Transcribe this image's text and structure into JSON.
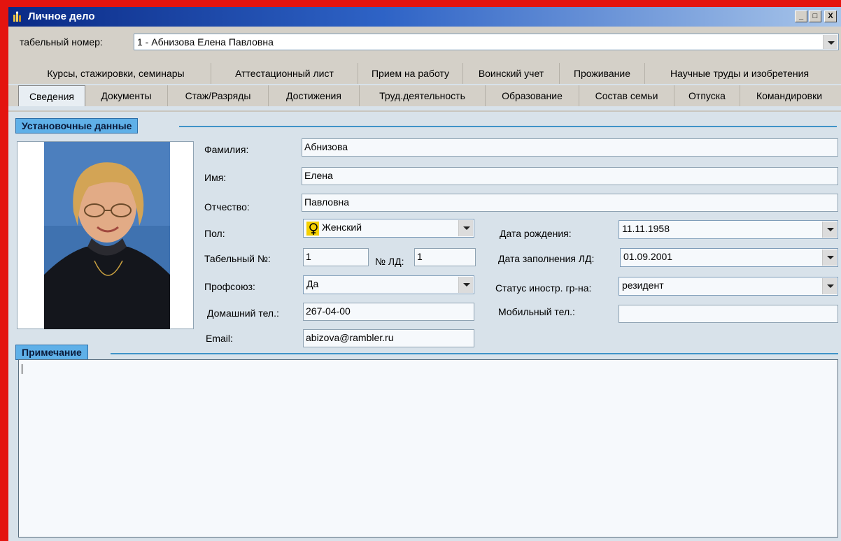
{
  "window": {
    "title": "Личное дело",
    "minimize": "_",
    "maximize": "□",
    "close": "X"
  },
  "header": {
    "tab_number_label": "табельный номер:",
    "tab_number_value": "1 - Абнизова Елена Павловна"
  },
  "tabs_row1": [
    "Курсы, стажировки, семинары",
    "Аттестационный лист",
    "Прием на работу",
    "Воинский учет",
    "Проживание",
    "Научные труды и изобретения"
  ],
  "tabs_row2": [
    "Сведения",
    "Документы",
    "Стаж/Разряды",
    "Достижения",
    "Труд.деятельность",
    "Образование",
    "Состав семьи",
    "Отпуска",
    "Командировки"
  ],
  "active_tab": "Сведения",
  "sections": {
    "basic": "Установочные данные",
    "notes": "Примечание"
  },
  "form": {
    "surname_label": "Фамилия:",
    "surname": "Абнизова",
    "name_label": "Имя:",
    "name": "Елена",
    "patronymic_label": "Отчество:",
    "patronymic": "Павловна",
    "gender_label": "Пол:",
    "gender": "Женский",
    "birth_label": "Дата рождения:",
    "birth": "11.11.1958",
    "tabnum_label": "Табельный №:",
    "tabnum": "1",
    "ld_label": "№ ЛД:",
    "ld": "1",
    "ld_date_label": "Дата заполнения ЛД:",
    "ld_date": "01.09.2001",
    "union_label": "Профсоюз:",
    "union": "Да",
    "status_label": "Статус иностр. гр-на:",
    "status": "резидент",
    "home_phone_label": "Домашний тел.:",
    "home_phone": "267-04-00",
    "mobile_label": "Мобильный тел.:",
    "mobile": "",
    "email_label": "Email:",
    "email": "abizova@rambler.ru"
  },
  "notes_text": ""
}
